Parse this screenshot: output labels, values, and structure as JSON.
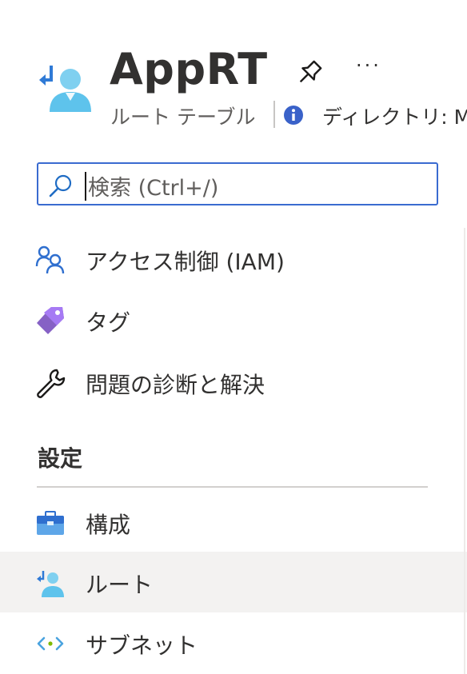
{
  "header": {
    "title": "AppRT",
    "subtitle": "ルート テーブル",
    "directory_text": "ディレクトリ: Mic",
    "more_label": "···"
  },
  "search": {
    "placeholder": "検索 (Ctrl+/)"
  },
  "menu": {
    "items": [
      {
        "label": "アクセス制御 (IAM)",
        "icon": "people-icon"
      },
      {
        "label": "タグ",
        "icon": "tag-icon"
      },
      {
        "label": "問題の診断と解決",
        "icon": "wrench-icon"
      }
    ],
    "section": "設定",
    "settings_items": [
      {
        "label": "構成",
        "icon": "briefcase-icon"
      },
      {
        "label": "ルート",
        "icon": "route-icon",
        "active": true
      },
      {
        "label": "サブネット",
        "icon": "subnet-icon"
      }
    ]
  },
  "colors": {
    "accent": "#0078d4",
    "search_border": "#3a6bd0",
    "active_bg": "#f3f2f1",
    "tag_purple": "#8661c5"
  }
}
